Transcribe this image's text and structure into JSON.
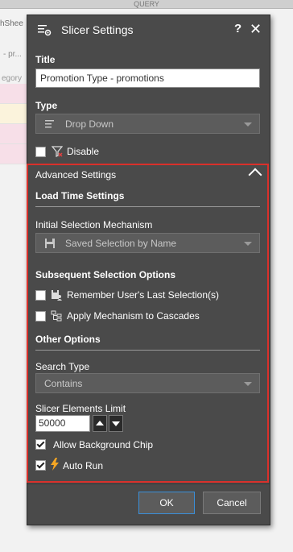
{
  "background": {
    "query_label": "QUERY",
    "tab_fragment": "hShee",
    "sub_fragment": "- pr...",
    "category_fragment": "egory"
  },
  "dialog": {
    "title": "Slicer Settings",
    "help": "?",
    "close": "✕"
  },
  "title_section": {
    "label": "Title",
    "value": "Promotion Type - promotions"
  },
  "type_section": {
    "label": "Type",
    "value": "Drop Down"
  },
  "disable": {
    "label": "Disable",
    "checked": false
  },
  "advanced": {
    "header": "Advanced Settings",
    "load_time_heading": "Load Time Settings",
    "initial_selection_label": "Initial Selection Mechanism",
    "initial_selection_value": "Saved Selection by Name",
    "subsequent_heading": "Subsequent Selection Options",
    "remember_label": "Remember User's Last Selection(s)",
    "apply_label": "Apply Mechanism to Cascades",
    "other_heading": "Other Options",
    "search_type_label": "Search Type",
    "search_type_value": "Contains",
    "limit_label": "Slicer Elements Limit",
    "limit_value": "50000",
    "allow_bg_label": "Allow Background Chip",
    "auto_run_label": "Auto Run"
  },
  "buttons": {
    "ok": "OK",
    "cancel": "Cancel"
  },
  "colors": {
    "dialog_bg": "#4a4a4a",
    "highlight_border": "#d9302b",
    "ok_border": "#3a8fd9",
    "lightning": "#f5a623"
  }
}
